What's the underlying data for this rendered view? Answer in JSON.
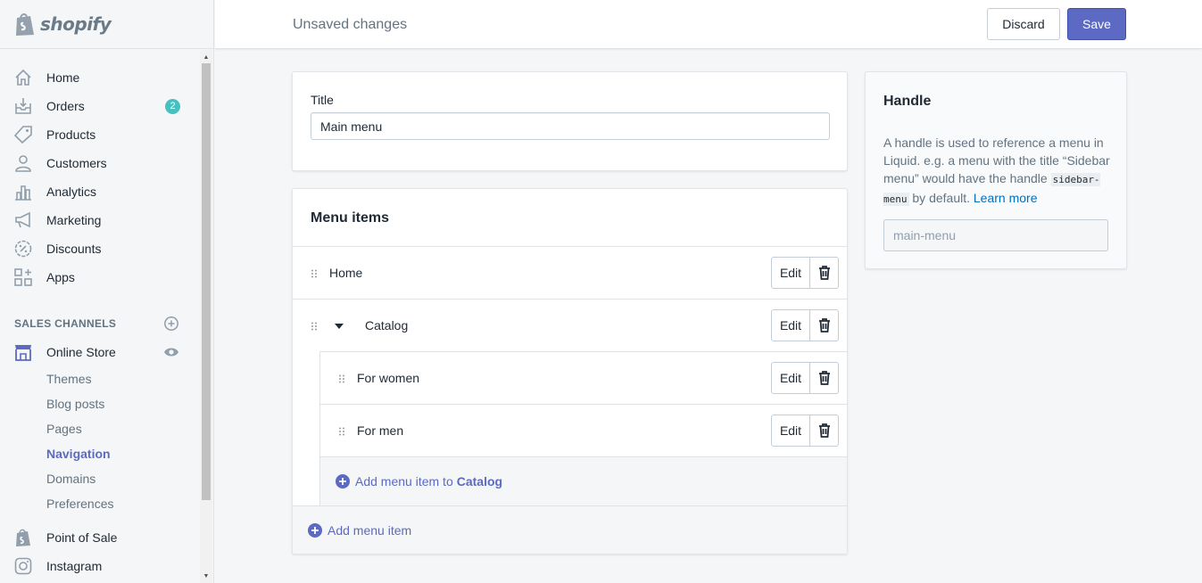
{
  "brand": {
    "name": "shopify"
  },
  "sidebar": {
    "items": [
      {
        "label": "Home",
        "icon": "home-icon"
      },
      {
        "label": "Orders",
        "icon": "orders-icon",
        "badge": "2"
      },
      {
        "label": "Products",
        "icon": "tag-icon"
      },
      {
        "label": "Customers",
        "icon": "person-icon"
      },
      {
        "label": "Analytics",
        "icon": "bar-chart-icon"
      },
      {
        "label": "Marketing",
        "icon": "megaphone-icon"
      },
      {
        "label": "Discounts",
        "icon": "discount-icon"
      },
      {
        "label": "Apps",
        "icon": "apps-icon"
      }
    ],
    "sales_channels_title": "SALES CHANNELS",
    "online_store": {
      "label": "Online Store",
      "icon": "store-icon"
    },
    "sub_items": [
      "Themes",
      "Blog posts",
      "Pages",
      "Navigation",
      "Domains",
      "Preferences"
    ],
    "active_sub_item": "Navigation",
    "point_of_sale": "Point of Sale",
    "instagram": "Instagram"
  },
  "topbar": {
    "title": "Unsaved changes",
    "discard_label": "Discard",
    "save_label": "Save"
  },
  "title_card": {
    "label": "Title",
    "value": "Main menu"
  },
  "menu_card": {
    "heading": "Menu items",
    "edit_label": "Edit",
    "items": [
      {
        "label": "Home"
      },
      {
        "label": "Catalog"
      },
      {
        "label": "For women"
      },
      {
        "label": "For men"
      }
    ],
    "add_child_text": "Add menu item to",
    "add_child_target": "Catalog",
    "add_root_text": "Add menu item"
  },
  "handle_card": {
    "title": "Handle",
    "desc_1": "A handle is used to reference a menu in Liquid. e.g. a menu with the title “Sidebar menu” would have the handle",
    "code": "sidebar-menu",
    "desc_2": "by default.",
    "learn_more": "Learn more",
    "input_value": "main-menu"
  },
  "colors": {
    "accent": "#5c6ac4",
    "badge": "#47c1bf",
    "link": "#006fbb",
    "sidebar_bg": "#f4f6f8"
  }
}
